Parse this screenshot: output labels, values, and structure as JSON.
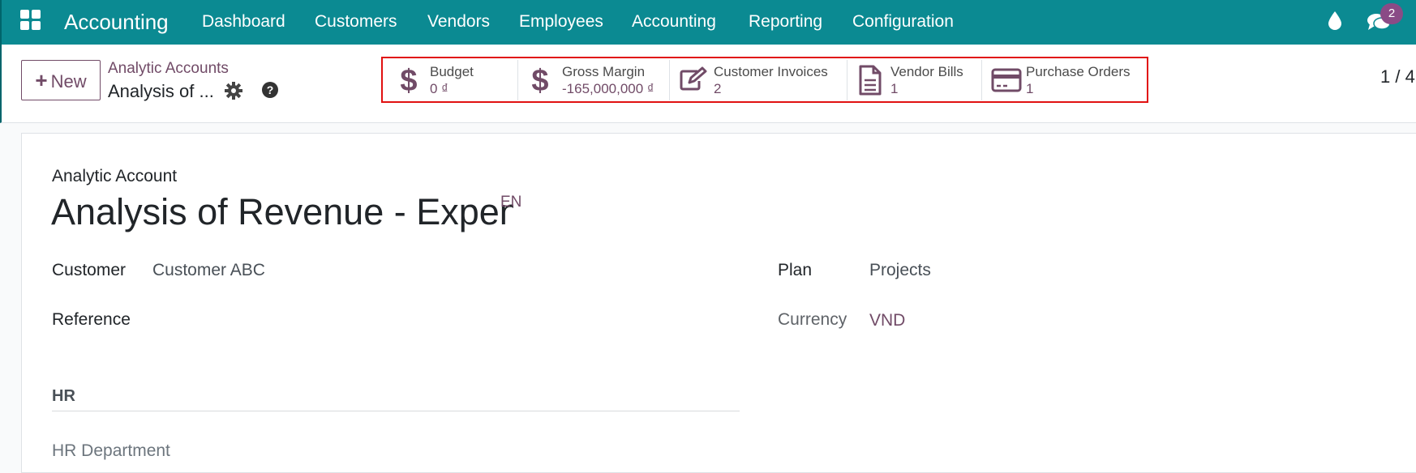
{
  "topbar": {
    "app_title": "Accounting",
    "nav": [
      "Dashboard",
      "Customers",
      "Vendors",
      "Employees",
      "Accounting",
      "Reporting",
      "Configuration"
    ],
    "chat_badge": "2",
    "colors": {
      "bar": "#0b8a92",
      "accent": "#714b67"
    }
  },
  "control_panel": {
    "new_label": "New",
    "breadcrumb_parent": "Analytic Accounts",
    "breadcrumb_current": "Analysis of ...",
    "pager": "1 / 4",
    "smart_buttons": [
      {
        "label": "Budget",
        "value": "0 ₫",
        "icon": "dollar-icon"
      },
      {
        "label": "Gross Margin",
        "value": "-165,000,000 ₫",
        "icon": "dollar-icon"
      },
      {
        "label": "Customer Invoices",
        "value": "2",
        "icon": "edit-icon"
      },
      {
        "label": "Vendor Bills",
        "value": "1",
        "icon": "document-icon"
      },
      {
        "label": "Purchase Orders",
        "value": "1",
        "icon": "credit-card-icon"
      }
    ]
  },
  "form": {
    "kicker": "Analytic Account",
    "title": "Analysis of Revenue - Expense",
    "lang": "EN",
    "customer_label": "Customer",
    "customer_value": "Customer ABC",
    "reference_label": "Reference",
    "plan_label": "Plan",
    "plan_value": "Projects",
    "currency_label": "Currency",
    "currency_value": "VND",
    "section_title": "HR",
    "hr_department_label": "HR Department"
  }
}
